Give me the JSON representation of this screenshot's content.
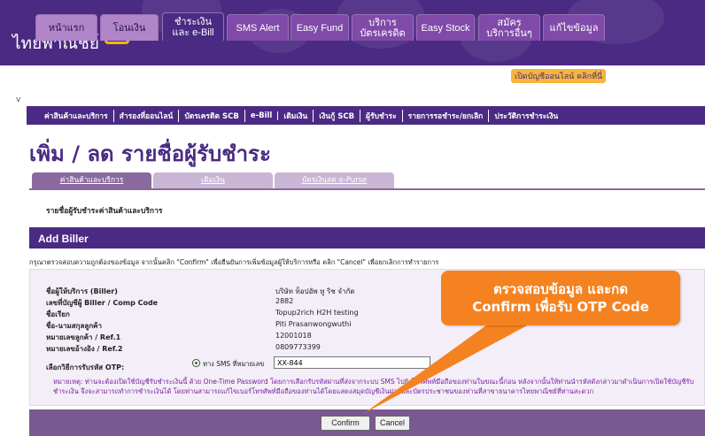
{
  "logo": {
    "brand": "SCB",
    "thai": "ไทยพาณิชย์"
  },
  "badge": "เปิดบัญชีออนไลน์ คลิกที่นี่",
  "v_mark": "v",
  "tabs": [
    {
      "label": "หน้าแรก"
    },
    {
      "label": "โอนเงิน"
    },
    {
      "label": "ชำระเงิน\nและ e-Bill"
    },
    {
      "label": "SMS Alert"
    },
    {
      "label": "Easy Fund"
    },
    {
      "label": "บริการ\nบัตรเครดิต"
    },
    {
      "label": "Easy Stock"
    },
    {
      "label": "สมัคร\nบริการอื่นๆ"
    },
    {
      "label": "แก้ไขข้อมูล"
    }
  ],
  "subnav": [
    "ค่าสินค้าและบริการ",
    "สำรองที่ออนไลน์",
    "บัตรเครดิต SCB",
    "e-Bill",
    "เติมเงิน",
    "เงินกู้ SCB",
    "ผู้รับชำระ",
    "รายการรอชำระ/ยกเลิก",
    "ประวัติการชำระเงิน"
  ],
  "page_title": "เพิ่ม / ลด รายชื่อผู้รับชำระ",
  "category_tabs": [
    "ค่าสินค้าและบริการ",
    "เติมเงิน",
    "บัตรเงินสด e-Purse"
  ],
  "section_label": "รายชื่อผู้รับชำระค่าสินค้าและบริการ",
  "add_biller_title": "Add Biller",
  "instruction": "กรุณาตรวจสอบความถูกต้องของข้อมูล จากนั้นคลิก \"Confirm\" เพื่อยืนยันการเพิ่มข้อมูลผู้ให้บริการหรือ คลิก \"Cancel\" เพื่อยกเลิกการทำรายการ",
  "fields": [
    {
      "label": "ชื่อผู้ให้บริการ (Biller)",
      "value": "บริษัท ท็อปอัพ ทู ริช จำกัด"
    },
    {
      "label": "เลขที่บัญชีผู้ Biller / Comp Code",
      "value": "2882"
    },
    {
      "label": "ชื่อเรียก",
      "value": "Topup2rich H2H testing"
    },
    {
      "label": "ชื่อ-นามสกุลลูกค้า",
      "value": "Piti Prasanwongwuthi"
    },
    {
      "label": "หมายเลขลูกค้า / Ref.1",
      "value": "12001018"
    },
    {
      "label": "หมายเลขอ้างอิง / Ref.2",
      "value": "0809773399"
    }
  ],
  "otp": {
    "label": "เลือกวิธีการรับรหัส OTP:",
    "option": "ทาง SMS ที่หมายเลข",
    "value": "XX-844"
  },
  "note": "หมายเหตุ: ท่านจะต้องเปิดใช้บัญชีรับชำระเงินนี้ ด้วย One-Time Password โดยการเลือกรับรหัสผ่านที่ส่งจากระบบ SMS ไปยังโทรศัพท์มือถือของท่านในขณะนี้ก่อน หลังจากนั้นให้ท่านนำรหัสดังกล่าวมาดำเนินการเปิดใช้บัญชีรับชำระเงิน จึงจะสามารถทำการชำระเงินได้ โดยท่านสามารถแก้ไขเบอร์โทรศัพท์มือถือของท่านได้โดยแสดงสมุดบัญชีเงินฝากและบัตรประชาชนของท่านที่สาขาธนาคารไทยพาณิชย์ที่ท่านสะดวก",
  "buttons": {
    "confirm": "Confirm",
    "cancel": "Cancel"
  },
  "callout": {
    "line1": "ตรวจสอบข้อมูล และกด",
    "line2": "Confirm เพื่อรับ OTP Code"
  },
  "colors": {
    "brand": "#4a2a83",
    "accent": "#f58220",
    "tab": "#b186c9"
  }
}
